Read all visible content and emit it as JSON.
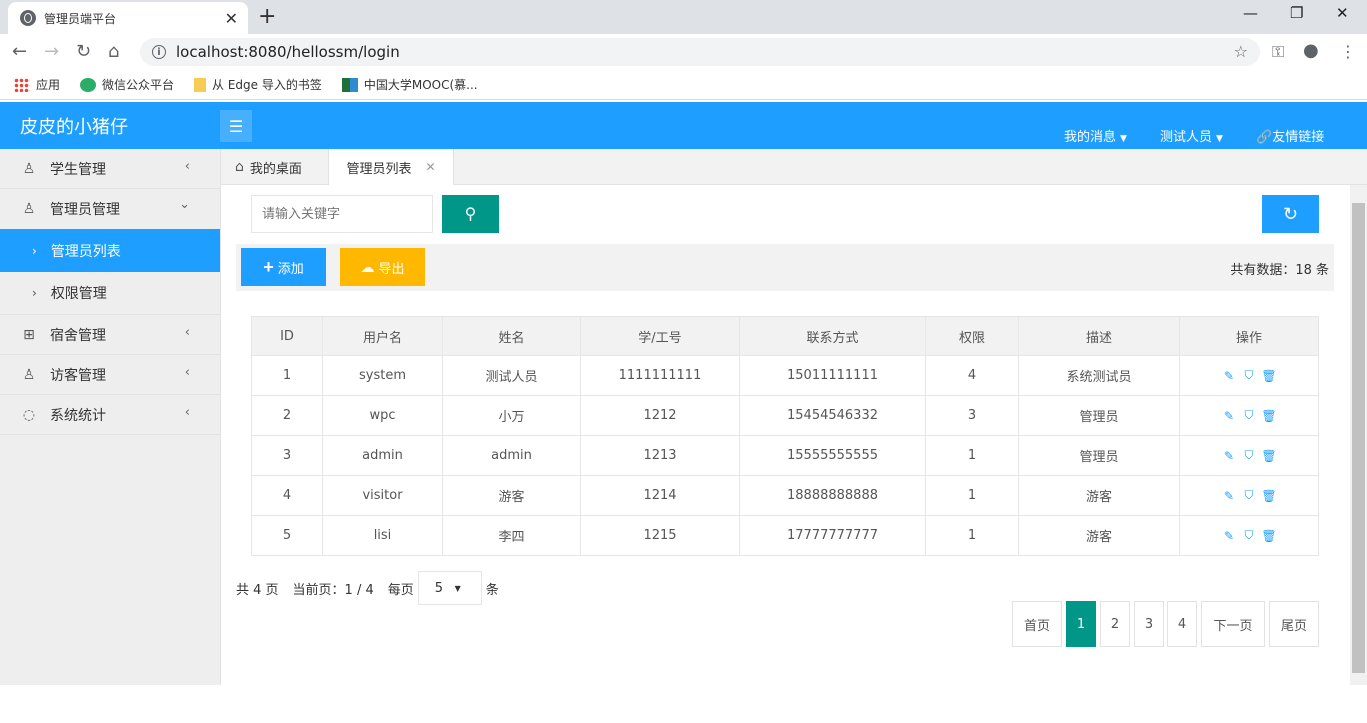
{
  "browser": {
    "tab_title": "管理员端平台",
    "url": "localhost:8080/hellossm/login",
    "bookmarks": [
      "应用",
      "微信公众平台",
      "从 Edge 导入的书签",
      "中国大学MOOC(慕..."
    ]
  },
  "header": {
    "logo": "皮皮的小猪仔",
    "nav": {
      "messages": "我的消息",
      "user": "测试人员",
      "links": "友情链接"
    }
  },
  "sidebar": {
    "items": [
      {
        "label": "学生管理",
        "icon": "user-icon"
      },
      {
        "label": "管理员管理",
        "icon": "admin-icon"
      },
      {
        "label": "宿舍管理",
        "icon": "grid-icon"
      },
      {
        "label": "访客管理",
        "icon": "visitor-icon"
      },
      {
        "label": "系统统计",
        "icon": "stats-icon"
      }
    ],
    "sub": [
      "管理员列表",
      "权限管理"
    ]
  },
  "tabs": {
    "home": "我的桌面",
    "current": "管理员列表"
  },
  "search": {
    "placeholder": "请输入关键字"
  },
  "toolbar": {
    "add": "添加",
    "export": "导出",
    "total": "共有数据：18 条"
  },
  "table": {
    "headers": [
      "ID",
      "用户名",
      "姓名",
      "学/工号",
      "联系方式",
      "权限",
      "描述",
      "操作"
    ],
    "rows": [
      [
        "1",
        "system",
        "测试人员",
        "1111111111",
        "15011111111",
        "4",
        "系统测试员"
      ],
      [
        "2",
        "wpc",
        "小万",
        "1212",
        "15454546332",
        "3",
        "管理员"
      ],
      [
        "3",
        "admin",
        "admin",
        "1213",
        "15555555555",
        "1",
        "管理员"
      ],
      [
        "4",
        "visitor",
        "游客",
        "1214",
        "18888888888",
        "1",
        "游客"
      ],
      [
        "5",
        "lisi",
        "李四",
        "1215",
        "17777777777",
        "1",
        "游客"
      ]
    ]
  },
  "pagination": {
    "total_pages": "共 4 页",
    "current": "当前页：1 / 4",
    "per_page_label": "每页",
    "per_page_value": "5",
    "unit": "条",
    "first": "首页",
    "pages": [
      "1",
      "2",
      "3",
      "4"
    ],
    "next": "下一页",
    "last": "尾页"
  }
}
